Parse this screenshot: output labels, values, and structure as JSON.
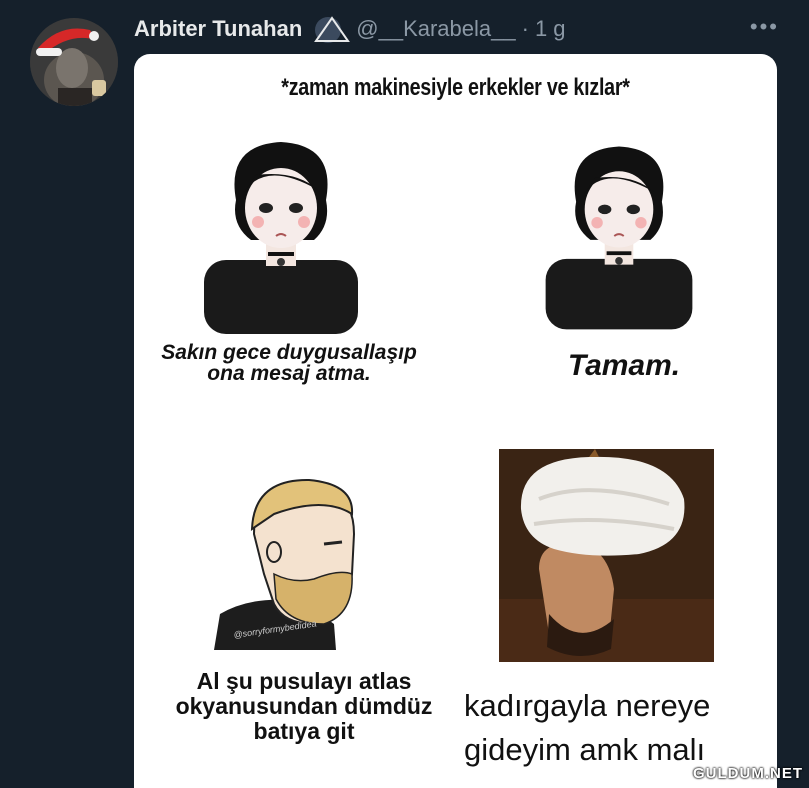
{
  "tweet": {
    "author_name": "Arbiter Tunahan",
    "handle": "@__Karabela__",
    "separator": "·",
    "time": "1 g",
    "more_label": "•••"
  },
  "meme": {
    "title": "*zaman makinesiyle erkekler ve kızlar*",
    "panel1_text": "Sakın gece duygusallaşıp ona mesaj atma.",
    "panel2_text": "Tamam.",
    "panel3_text": "Al şu pusulayı atlas okyanusundan dümdüz batıya git",
    "panel3_chin_text": "@sorryformybedidea",
    "panel4_line1": "kadırgayla nereye",
    "panel4_line2": "gideyim amk malı",
    "watermark": "GULDUM.NET"
  },
  "icons": {
    "verified_badge": "triangle-icon",
    "more": "more-icon",
    "avatar": "avatar"
  }
}
